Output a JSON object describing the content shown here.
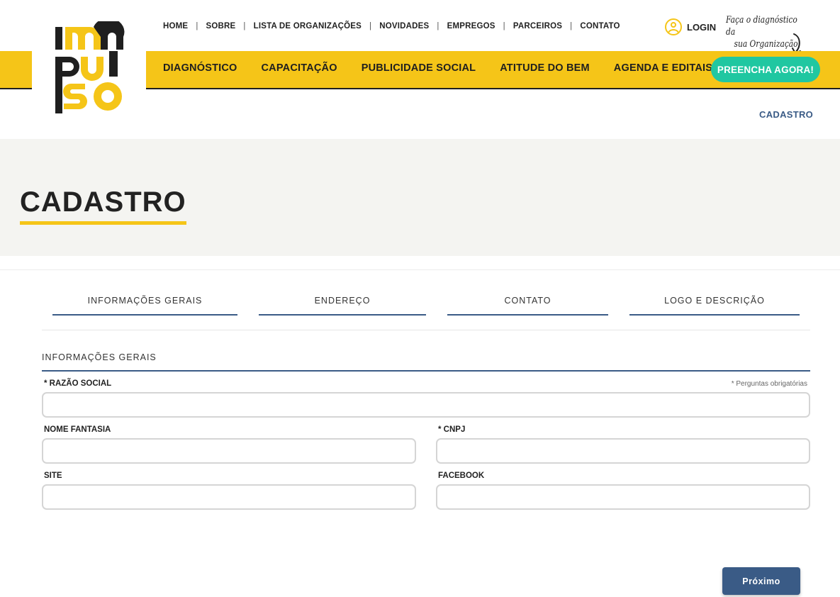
{
  "brand": {
    "logo_lines": [
      "im",
      "pul",
      "so"
    ],
    "logo_colors": {
      "yellow": "#f5c518",
      "black": "#1f1f1f"
    }
  },
  "top_nav": [
    {
      "label": "HOME"
    },
    {
      "label": "SOBRE"
    },
    {
      "label": "LISTA DE ORGANIZAÇÕES"
    },
    {
      "label": "NOVIDADES"
    },
    {
      "label": "EMPREGOS"
    },
    {
      "label": "PARCEIROS"
    },
    {
      "label": "CONTATO"
    }
  ],
  "top_nav_separator": "|",
  "login": {
    "label": "LOGIN",
    "icon": "user-circle-icon"
  },
  "handwritten_note": {
    "line1": "Faça o diagnóstico da",
    "line2": "sua Organização",
    "icon": "curved-arrow-icon"
  },
  "main_nav": [
    {
      "label": "DIAGNÓSTICO"
    },
    {
      "label": "CAPACITAÇÃO"
    },
    {
      "label": "PUBLICIDADE SOCIAL"
    },
    {
      "label": "ATITUDE DO BEM"
    },
    {
      "label": "AGENDA E EDITAIS"
    }
  ],
  "cta": {
    "label": "PREENCHA AGORA!",
    "color": "#20c7a1"
  },
  "breadcrumb": "CADASTRO",
  "page_title": "CADASTRO",
  "steps": [
    {
      "label": "INFORMAÇÕES GERAIS"
    },
    {
      "label": "ENDEREÇO"
    },
    {
      "label": "CONTATO"
    },
    {
      "label": "LOGO E DESCRIÇÃO"
    }
  ],
  "form": {
    "section_title": "INFORMAÇÕES GERAIS",
    "required_note": "* Perguntas obrigatórias",
    "fields": {
      "razao_social": {
        "label": "* RAZÃO SOCIAL",
        "value": ""
      },
      "nome_fantasia": {
        "label": "NOME FANTASIA",
        "value": ""
      },
      "cnpj": {
        "label": "* CNPJ",
        "value": ""
      },
      "site": {
        "label": "SITE",
        "value": ""
      },
      "facebook": {
        "label": "FACEBOOK",
        "value": ""
      }
    }
  },
  "next_button": "Próximo",
  "colors": {
    "accent_yellow": "#f5c518",
    "accent_blue": "#3a5b86",
    "hero_bg": "#f4f4f1"
  }
}
